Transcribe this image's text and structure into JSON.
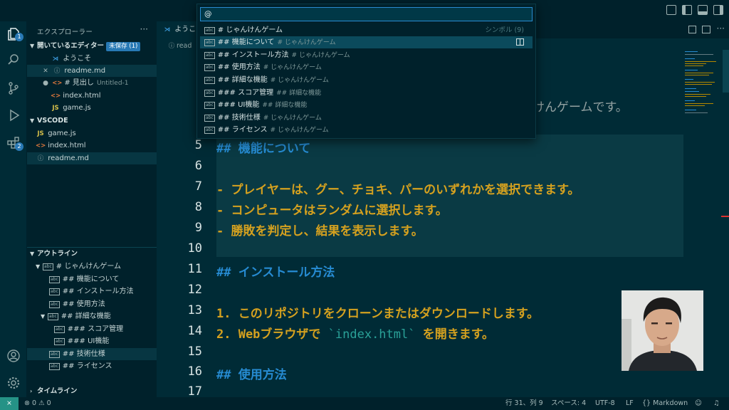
{
  "sidebar": {
    "title": "エクスプローラー",
    "open_editors": {
      "label": "開いているエディター",
      "unsaved": "未保存 (1)",
      "items": [
        {
          "name": "ようこそ",
          "icon": "vscode-icon"
        },
        {
          "name": "readme.md",
          "icon": "info-icon"
        },
        {
          "name": "# 見出し",
          "sub": "Untitled-1",
          "icon": "html-icon"
        },
        {
          "name": "index.html",
          "icon": "html-icon"
        },
        {
          "name": "game.js",
          "icon": "js-icon"
        }
      ]
    },
    "workspace": {
      "label": "VSCODE",
      "files": [
        "game.js",
        "index.html",
        "readme.md"
      ]
    },
    "outline": {
      "label": "アウトライン",
      "items": [
        "# じゃんけんゲーム",
        "## 機能について",
        "## インストール方法",
        "## 使用方法",
        "## 詳細な機能",
        "### スコア管理",
        "### UI機能",
        "## 技術仕様",
        "## ライセンス"
      ]
    },
    "timeline": {
      "label": "タイムライン"
    }
  },
  "editor": {
    "tab": "ようこ",
    "breadcrumb": "read",
    "lines": [
      {
        "n": "5",
        "text": "##  機能について"
      },
      {
        "n": "6",
        "text": ""
      },
      {
        "n": "7",
        "text": "- プレイヤーは、グー、チョキ、パーのいずれかを選択できます。"
      },
      {
        "n": "8",
        "text": "- コンピュータはランダムに選択します。"
      },
      {
        "n": "9",
        "text": "- 勝敗を判定し、結果を表示します。"
      },
      {
        "n": "10",
        "text": ""
      },
      {
        "n": "11",
        "text": "## インストール方法"
      },
      {
        "n": "12",
        "text": ""
      },
      {
        "n": "13",
        "text": "1. このリポジトリをクローンまたはダウンロードします。"
      },
      {
        "n": "14a",
        "text": "2. Webブラウザで "
      },
      {
        "n": "14b",
        "text": "`index.html`"
      },
      {
        "n": "14c",
        "text": " を開きます。"
      },
      {
        "n": "15",
        "text": ""
      },
      {
        "n": "16",
        "text": "## 使用方法"
      },
      {
        "n": "17",
        "text": ""
      }
    ],
    "partial_line": "けんゲームです。"
  },
  "palette": {
    "input": "@",
    "count": "シンボル (9)",
    "items": [
      {
        "label": "# じゃんけんゲーム",
        "desc": ""
      },
      {
        "label": "## 機能について",
        "desc": "# じゃんけんゲーム"
      },
      {
        "label": "## インストール方法",
        "desc": "# じゃんけんゲーム"
      },
      {
        "label": "## 使用方法",
        "desc": "# じゃんけんゲーム"
      },
      {
        "label": "## 詳細な機能",
        "desc": "# じゃんけんゲーム"
      },
      {
        "label": "### スコア管理",
        "desc": "## 詳細な機能"
      },
      {
        "label": "### UI機能",
        "desc": "## 詳細な機能"
      },
      {
        "label": "## 技術仕様",
        "desc": "# じゃんけんゲーム"
      },
      {
        "label": "## ライセンス",
        "desc": "# じゃんけんゲーム"
      }
    ]
  },
  "status": {
    "errors": "0",
    "warnings": "0",
    "position": "行 31、列 9",
    "spaces": "スペース: 4",
    "encoding": "UTF-8",
    "eol": "LF",
    "language": "Markdown"
  },
  "badges": {
    "explorer": "1",
    "extensions": "2"
  },
  "colors": {
    "background": "#002b36",
    "heading": "#268bd2",
    "list": "#d5a11f",
    "accent": "#2979b6"
  }
}
